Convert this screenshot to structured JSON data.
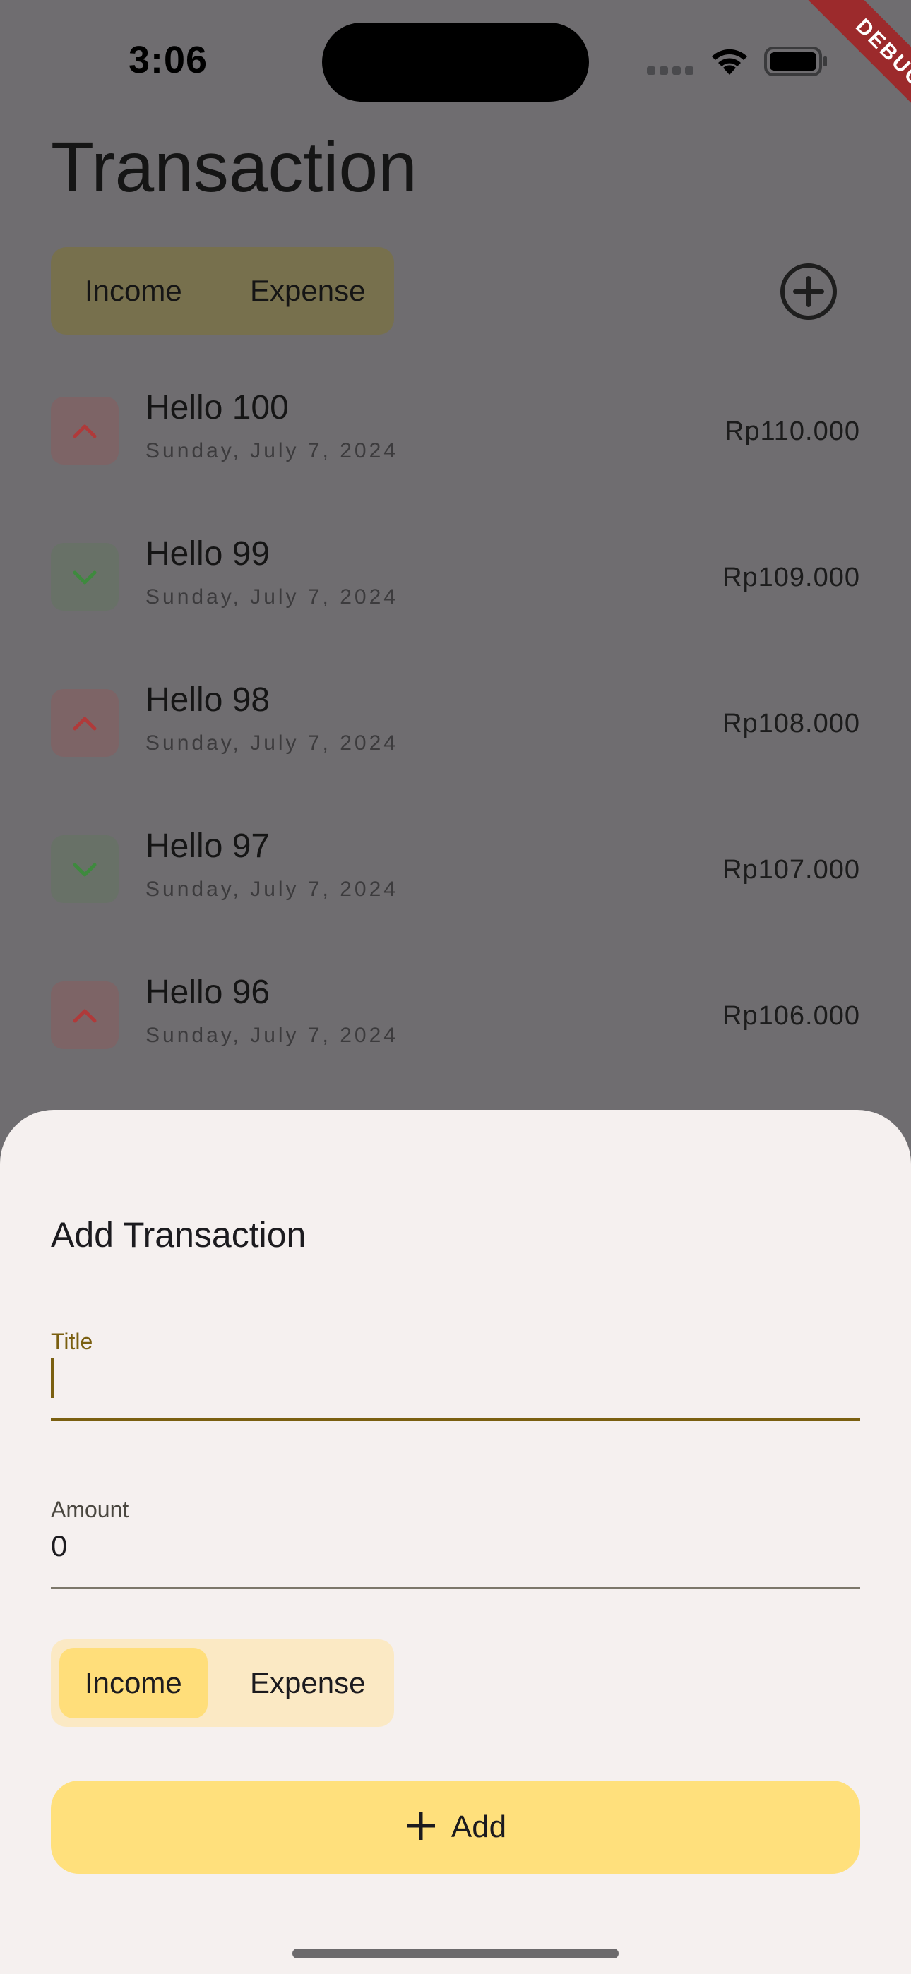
{
  "status_bar": {
    "time": "3:06",
    "icons": [
      "cellular-signal-icon",
      "wifi-icon",
      "battery-icon"
    ]
  },
  "debug_banner": "DEBUG",
  "page": {
    "title": "Transaction",
    "filter": {
      "options": [
        "Income",
        "Expense"
      ]
    },
    "add_icon": "add-circle-icon"
  },
  "transactions": [
    {
      "name": "Hello 100",
      "date": "Sunday, July 7, 2024",
      "amount": "Rp110.000",
      "direction": "up"
    },
    {
      "name": "Hello 99",
      "date": "Sunday, July 7, 2024",
      "amount": "Rp109.000",
      "direction": "down"
    },
    {
      "name": "Hello 98",
      "date": "Sunday, July 7, 2024",
      "amount": "Rp108.000",
      "direction": "up"
    },
    {
      "name": "Hello 97",
      "date": "Sunday, July 7, 2024",
      "amount": "Rp107.000",
      "direction": "down"
    },
    {
      "name": "Hello 96",
      "date": "Sunday, July 7, 2024",
      "amount": "Rp106.000",
      "direction": "up"
    }
  ],
  "sheet": {
    "title": "Add Transaction",
    "title_field": {
      "label": "Title",
      "value": ""
    },
    "amount_field": {
      "label": "Amount",
      "value": "0"
    },
    "type_toggle": {
      "options": [
        "Income",
        "Expense"
      ],
      "selected": "Income"
    },
    "submit_label": "Add"
  },
  "colors": {
    "accent": "#ffe07c",
    "toggle_selected": "#ffde7a",
    "focus": "#7a5f10",
    "income_icon": "#b03a3a",
    "expense_icon": "#3e8a3e"
  }
}
